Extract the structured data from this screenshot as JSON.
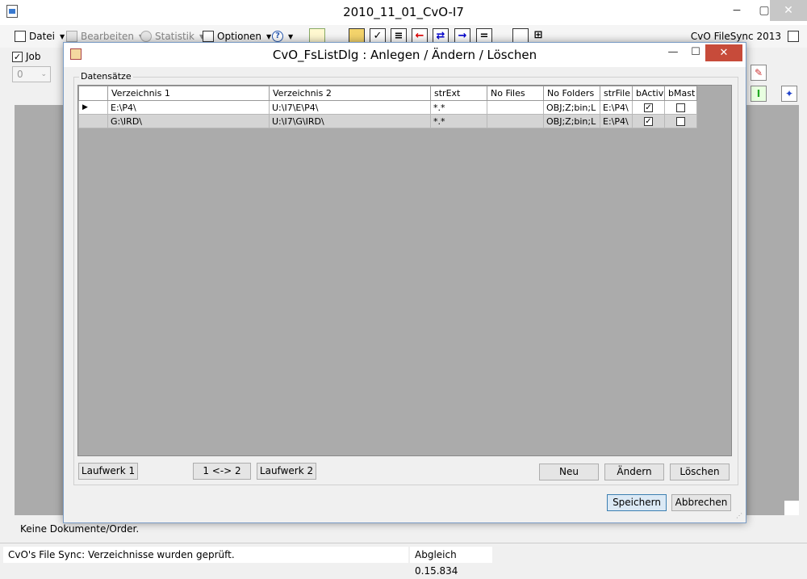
{
  "window": {
    "title": "2010_11_01_CvO-I7",
    "minimize": "−",
    "maximize": "▢",
    "close": "✕"
  },
  "toolbar": {
    "datei": "Datei",
    "bearbeiten": "Bearbeiten",
    "statistik": "Statistik",
    "optionen": "Optionen",
    "help": "?",
    "brand": "CvO FileSync 2013"
  },
  "job": {
    "checked": "✓",
    "label": "Job",
    "select_value": "0"
  },
  "status": {
    "message": "Keine Dokumente/Order.",
    "left": "CvO's File Sync: Verzeichnisse wurden geprüft.",
    "right": "Abgleich 0.15.834"
  },
  "dialog": {
    "title": "CvO_FsListDlg : Anlegen / Ändern / Löschen",
    "minimize": "—",
    "maximize": "☐",
    "close": "✕",
    "group_label": "Datensätze",
    "columns": [
      "Verzeichnis 1",
      "Verzeichnis 2",
      "strExt",
      "No Files",
      "No Folders",
      "strFile",
      "bActiv",
      "bMast"
    ],
    "rows": [
      {
        "marker": "▶",
        "v1": "E:\\P4\\",
        "v2": "U:\\I7\\E\\P4\\",
        "ext": "*.*",
        "nofiles": "",
        "nofolders": "OBJ;Z;bin;L",
        "strfile": "E:\\P4\\",
        "bactiv": "✓",
        "bmast": ""
      },
      {
        "marker": "",
        "v1": "G:\\IRD\\",
        "v2": "U:\\I7\\G\\IRD\\",
        "ext": "*.*",
        "nofiles": "",
        "nofolders": "OBJ;Z;bin;L",
        "strfile": "E:\\P4\\",
        "bactiv": "✓",
        "bmast": ""
      }
    ],
    "buttons": {
      "laufwerk1": "Laufwerk 1",
      "swap": "1 <-> 2",
      "laufwerk2": "Laufwerk 2",
      "neu": "Neu",
      "aendern": "Ändern",
      "loeschen": "Löschen",
      "speichern": "Speichern",
      "abbrechen": "Abbrechen"
    }
  }
}
